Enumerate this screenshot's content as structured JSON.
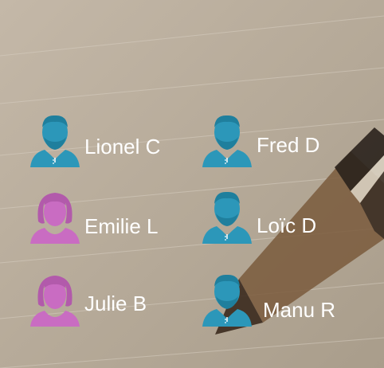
{
  "contacts": [
    {
      "name": "Lionel C",
      "avatar": "male-avatar-icon",
      "color": "#2c97b9"
    },
    {
      "name": "Fred D",
      "avatar": "male-avatar-icon",
      "color": "#2c97b9"
    },
    {
      "name": "Emilie L",
      "avatar": "female-avatar-icon",
      "color": "#c96cc2"
    },
    {
      "name": "Loïc D",
      "avatar": "male-avatar-icon",
      "color": "#2c97b9"
    },
    {
      "name": "Julie B",
      "avatar": "female-avatar-icon",
      "color": "#c96cc2"
    },
    {
      "name": "Manu R",
      "avatar": "male-avatar-icon",
      "color": "#2c97b9"
    }
  ],
  "colors": {
    "male": "#2c97b9",
    "female": "#c96cc2",
    "text": "#ffffff"
  }
}
